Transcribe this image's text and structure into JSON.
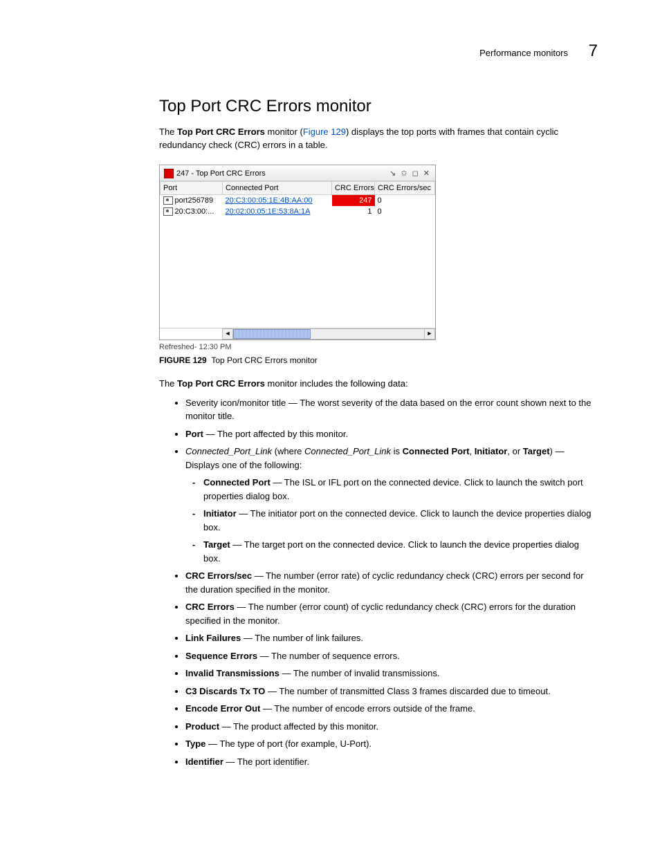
{
  "header": {
    "section": "Performance monitors",
    "chapter": "7"
  },
  "h2": "Top Port CRC Errors monitor",
  "intro": {
    "pre": "The ",
    "b1": "Top Port CRC Errors",
    "mid": " monitor (",
    "link": "Figure 129",
    "post": ") displays the top ports with frames that contain cyclic redundancy check (CRC) errors in a table."
  },
  "fig": {
    "title": "247 - Top Port CRC Errors",
    "cols": [
      "Port",
      "Connected Port",
      "CRC Errors",
      "CRC Errors/sec"
    ],
    "rows": [
      {
        "port": "port256789",
        "conn": "20:C3:00:05:1E:4B:AA:00",
        "err": "247",
        "rate": "0",
        "hl": true
      },
      {
        "port": "20:C3:00:...",
        "conn": "20:02:00:05:1E:53:8A:1A",
        "err": "1",
        "rate": "0",
        "hl": false
      }
    ],
    "refreshed": "Refreshed- 12:30 PM"
  },
  "caption": {
    "pre": "FIGURE 129",
    "post": "Top Port CRC Errors monitor"
  },
  "lead": {
    "pre": "The ",
    "b": "Top Port CRC Errors",
    "post": " monitor includes the following data:"
  },
  "bullets": [
    {
      "t": "plain",
      "text": "Severity icon/monitor title — The worst severity of the data based on the error count shown next to the monitor title."
    },
    {
      "t": "bold",
      "b": "Port",
      "text": " — The port affected by this monitor."
    },
    {
      "t": "cpl",
      "i1": "Connected_Port_Link",
      "mid": " (where ",
      "i2": "Connected_Port_Link",
      "mid2": " is ",
      "b1": "Connected Port",
      "sep": ", ",
      "b2": "Initiator",
      "sep2": ", or ",
      "b3": "Target",
      "post": ") — Displays one of the following:",
      "sub": [
        {
          "b": "Connected Port",
          "text": " — The ISL or IFL port on the connected device. Click to launch the switch port properties dialog box."
        },
        {
          "b": "Initiator",
          "text": " — The initiator port on the connected device. Click to launch the device properties dialog box."
        },
        {
          "b": "Target",
          "text": " — The target port on the connected device. Click to launch the device properties dialog box."
        }
      ]
    },
    {
      "t": "bold",
      "b": "CRC Errors/sec",
      "text": " — The number (error rate) of cyclic redundancy check (CRC) errors per second for the duration specified in the monitor."
    },
    {
      "t": "bold",
      "b": "CRC Errors",
      "text": " — The number (error count) of cyclic redundancy check (CRC) errors for the duration specified in the monitor."
    },
    {
      "t": "bold",
      "b": "Link Failures",
      "text": " — The number of link failures."
    },
    {
      "t": "bold",
      "b": "Sequence Errors",
      "text": " — The number of sequence errors."
    },
    {
      "t": "bold",
      "b": "Invalid Transmissions",
      "text": " — The number of invalid transmissions."
    },
    {
      "t": "bold",
      "b": "C3 Discards Tx TO",
      "text": " — The number of transmitted Class 3 frames discarded due to timeout."
    },
    {
      "t": "bold",
      "b": "Encode Error Out",
      "text": " — The number of encode errors outside of the frame."
    },
    {
      "t": "bold",
      "b": "Product",
      "text": " — The product affected by this monitor."
    },
    {
      "t": "bold",
      "b": "Type",
      "text": " — The type of port (for example, U-Port)."
    },
    {
      "t": "bold",
      "b": "Identifier",
      "text": " — The port identifier."
    }
  ]
}
